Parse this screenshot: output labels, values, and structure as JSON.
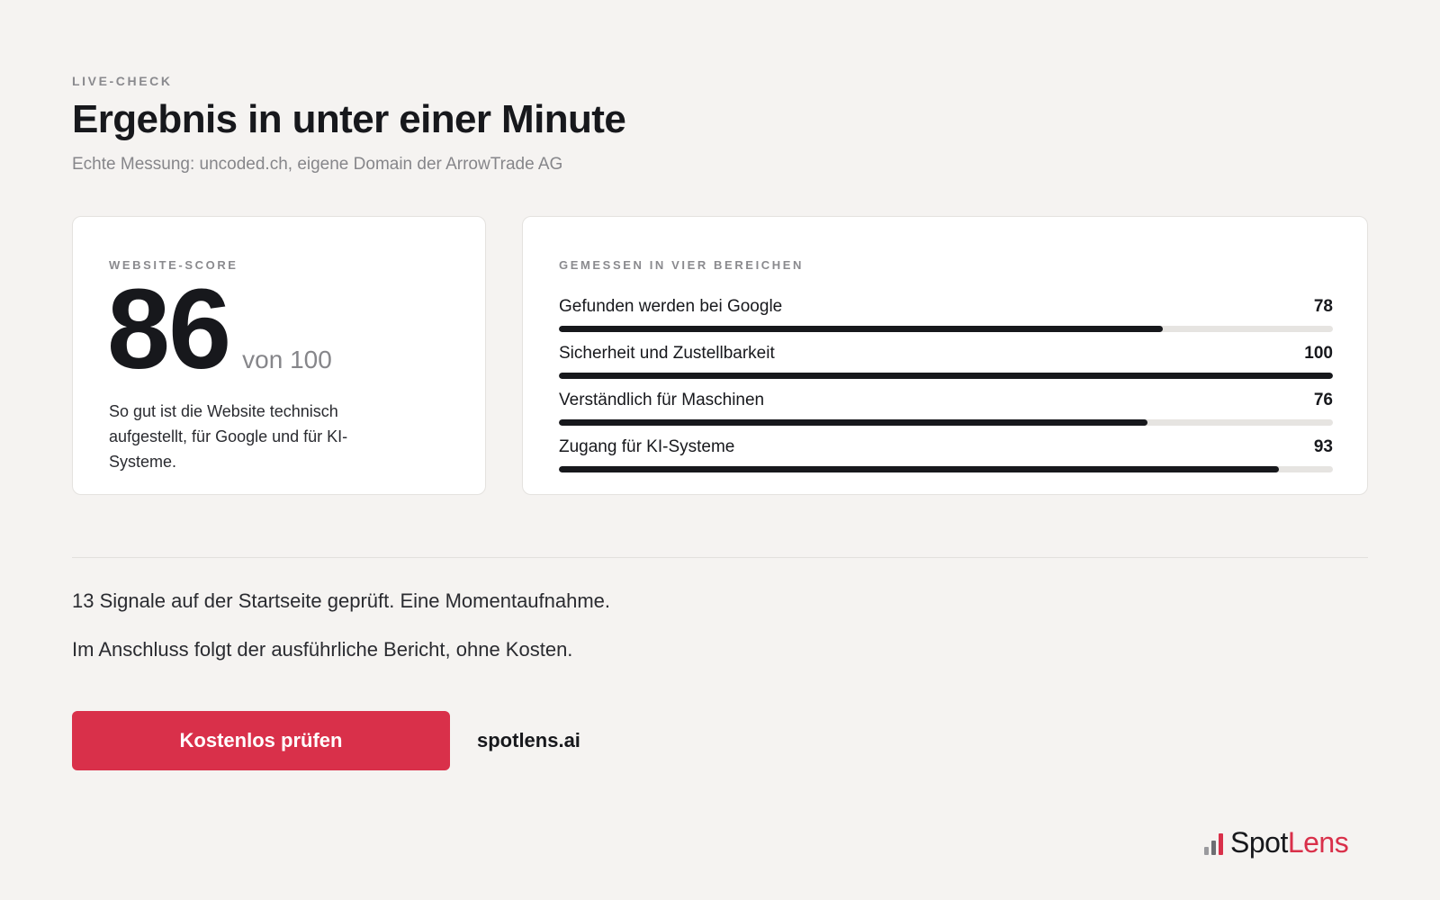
{
  "header": {
    "eyebrow": "LIVE-CHECK",
    "title": "Ergebnis in unter einer Minute",
    "subtitle": "Echte Messung: uncoded.ch, eigene Domain der ArrowTrade AG"
  },
  "score_card": {
    "label": "WEBSITE-SCORE",
    "score": "86",
    "max_label": "von 100",
    "description": "So gut ist die Website technisch aufgestellt, für Google und für KI-Systeme."
  },
  "areas_card": {
    "label": "GEMESSEN IN VIER BEREICHEN",
    "items": [
      {
        "label": "Gefunden werden bei Google",
        "value": "78",
        "progress": 78
      },
      {
        "label": "Sicherheit und Zustellbarkeit",
        "value": "100",
        "progress": 100
      },
      {
        "label": "Verständlich für Maschinen",
        "value": "76",
        "progress": 76
      },
      {
        "label": "Zugang für KI-Systeme",
        "value": "93",
        "progress": 93
      }
    ]
  },
  "info": {
    "line1": "13 Signale auf der Startseite geprüft. Eine Momentaufnahme.",
    "line2": "Im Anschluss folgt der ausführliche Bericht, ohne Kosten."
  },
  "cta": {
    "button_label": "Kostenlos prüfen",
    "link_label": "spotlens.ai"
  },
  "brand": {
    "name_part1": "Spot",
    "name_part2": "Lens",
    "icon": "bar-chart-icon"
  },
  "colors": {
    "accent": "#d9304a",
    "background": "#f5f3f1",
    "text": "#17181c",
    "muted": "#86868a",
    "bar_fill": "#17181c",
    "bar_track": "#e6e4e1"
  }
}
